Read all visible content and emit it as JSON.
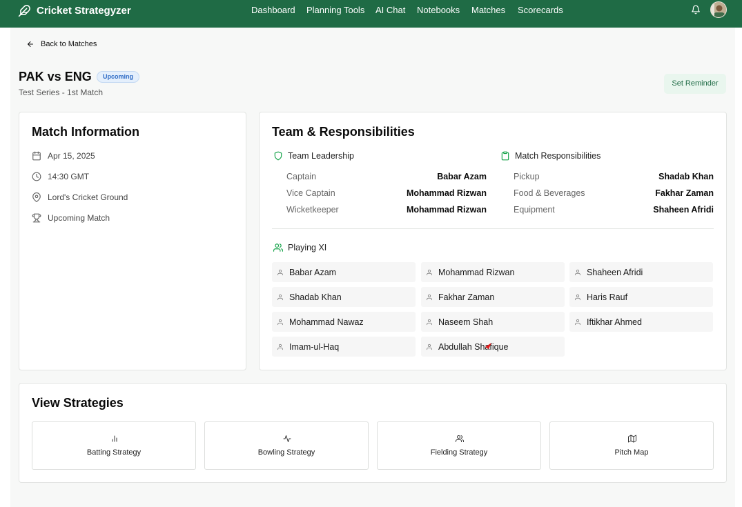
{
  "app": {
    "name": "Cricket Strategyzer"
  },
  "nav": {
    "items": [
      "Dashboard",
      "Planning Tools",
      "AI Chat",
      "Notebooks",
      "Matches",
      "Scorecards"
    ]
  },
  "header": {
    "back_label": "Back to Matches",
    "title": "PAK vs ENG",
    "badge": "Upcoming",
    "subtitle": "Test Series - 1st Match",
    "reminder_label": "Set Reminder"
  },
  "match_info": {
    "title": "Match Information",
    "date": "Apr 15, 2025",
    "time": "14:30 GMT",
    "venue": "Lord's Cricket Ground",
    "status": "Upcoming Match"
  },
  "team": {
    "title": "Team & Responsibilities",
    "leadership": {
      "heading": "Team Leadership",
      "rows": [
        {
          "label": "Captain",
          "value": "Babar Azam"
        },
        {
          "label": "Vice Captain",
          "value": "Mohammad Rizwan"
        },
        {
          "label": "Wicketkeeper",
          "value": "Mohammad Rizwan"
        }
      ]
    },
    "responsibilities": {
      "heading": "Match Responsibilities",
      "rows": [
        {
          "label": "Pickup",
          "value": "Shadab Khan"
        },
        {
          "label": "Food & Beverages",
          "value": "Fakhar Zaman"
        },
        {
          "label": "Equipment",
          "value": "Shaheen Afridi"
        }
      ]
    },
    "playing_xi": {
      "heading": "Playing XI",
      "players": [
        "Babar Azam",
        "Mohammad Rizwan",
        "Shaheen Afridi",
        "Shadab Khan",
        "Fakhar Zaman",
        "Haris Rauf",
        "Mohammad Nawaz",
        "Naseem Shah",
        "Iftikhar Ahmed",
        "Imam-ul-Haq",
        "Abdullah Shafique"
      ]
    }
  },
  "strategies": {
    "title": "View Strategies",
    "items": [
      {
        "label": "Batting Strategy",
        "icon": "bar-chart-icon"
      },
      {
        "label": "Bowling Strategy",
        "icon": "activity-icon"
      },
      {
        "label": "Fielding Strategy",
        "icon": "users-icon"
      },
      {
        "label": "Pitch Map",
        "icon": "map-icon"
      }
    ]
  },
  "colors": {
    "brand": "#1f6b45",
    "accent": "#16a34a",
    "badge_text": "#2e6bc5",
    "badge_bg": "#e4effc"
  }
}
